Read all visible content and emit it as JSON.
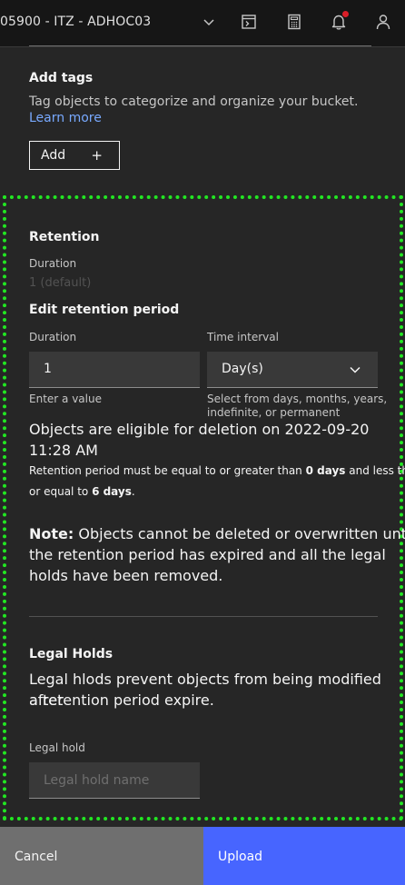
{
  "header": {
    "account": "05900 - ITZ - ADHOC03"
  },
  "tags": {
    "title": "Add tags",
    "description": "Tag objects to categorize and organize your bucket.",
    "learn_more": "Learn more",
    "add_label": "Add",
    "add_icon": "+"
  },
  "retention": {
    "title": "Retention",
    "duration_label": "Duration",
    "duration_value": "1 (default)",
    "edit_title": "Edit retention period",
    "duration_field_label": "Duration",
    "duration_field_value": "1",
    "duration_helper": "Enter a value",
    "interval_label": "Time interval",
    "interval_value": "Day(s)",
    "interval_helper_1": "Select from days, months, years,",
    "interval_helper_2": "indefinite, or permanent",
    "eligible_line1": "Objects are eligible for deletion on 2022-09-20",
    "eligible_line2": "11:28 AM",
    "rule_pre": "Retention period must be equal to or greater than ",
    "rule_min": "0 days",
    "rule_mid": " and less than",
    "rule_pre2": "or equal to ",
    "rule_max": "6 days",
    "rule_end": ".",
    "note_label": "Note:",
    "note_line1": " Objects cannot be deleted or overwritten until",
    "note_line2": "the retention period has expired and all the legal",
    "note_line3": "holds have been removed."
  },
  "legal_holds": {
    "title": "Legal Holds",
    "desc_line1": "Legal hlods prevent objects from being modified after",
    "desc_line2": "a retention period expire.",
    "field_label": "Legal hold",
    "placeholder": "Legal hold name"
  },
  "footer": {
    "cancel": "Cancel",
    "upload": "Upload"
  },
  "colors": {
    "highlight": "#22e622",
    "primary_button": "#4765ff",
    "link": "#78a9ff",
    "notification_dot": "#da1e28"
  },
  "icons": [
    "chevron-down-icon",
    "terminal-icon",
    "calculator-icon",
    "notification-icon",
    "user-icon",
    "add-icon"
  ]
}
